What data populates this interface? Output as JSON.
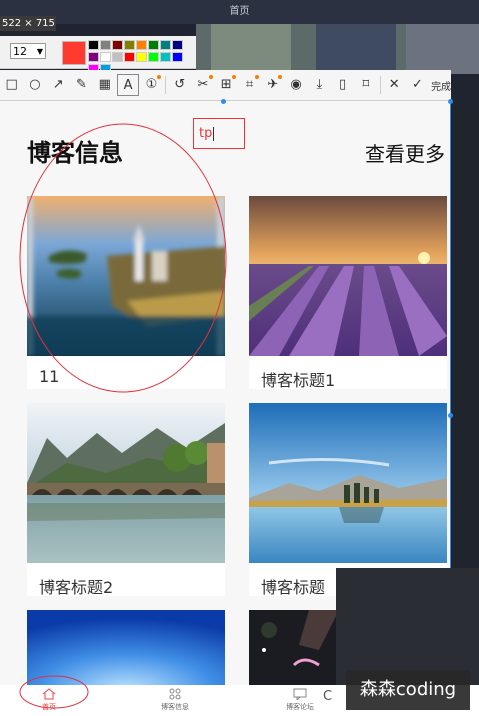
{
  "app": {
    "window_title": "首页",
    "capture_dims": "522 × 715"
  },
  "style_toolbar": {
    "font_size": "12",
    "current_color": "#ff3b30",
    "palette": [
      "#000000",
      "#808080",
      "#800000",
      "#808000",
      "#ff8000",
      "#008000",
      "#008080",
      "#000080",
      "#800080",
      "#ffffff",
      "#c0c0c0",
      "#ff0000",
      "#ffff00",
      "#00ff00",
      "#00c0c0",
      "#0000ff",
      "#ff00ff",
      "#00a0e0"
    ]
  },
  "tools": [
    {
      "name": "rectangle-tool",
      "glyph": "□"
    },
    {
      "name": "ellipse-tool",
      "glyph": "○"
    },
    {
      "name": "arrow-tool",
      "glyph": "↗"
    },
    {
      "name": "pencil-tool",
      "glyph": "✎"
    },
    {
      "name": "mosaic-tool",
      "glyph": "▦"
    },
    {
      "name": "text-tool",
      "glyph": "A",
      "selected": true
    },
    {
      "name": "number-tool",
      "glyph": "①",
      "dot": true
    },
    {
      "name": "undo-tool",
      "glyph": "↺",
      "sep_before": true
    },
    {
      "name": "scissors-tool",
      "glyph": "✂",
      "dot": true
    },
    {
      "name": "ocr-tool",
      "glyph": "⊞",
      "dot": true
    },
    {
      "name": "crop-tool",
      "glyph": "⌗",
      "dot": true
    },
    {
      "name": "pin-tool",
      "glyph": "✈",
      "dot": true
    },
    {
      "name": "record-tool",
      "glyph": "◉"
    },
    {
      "name": "download-tool",
      "glyph": "⤓"
    },
    {
      "name": "phone-tool",
      "glyph": "▯"
    },
    {
      "name": "bookmark-tool",
      "glyph": "⌑"
    },
    {
      "name": "close-tool",
      "glyph": "✕",
      "sep_before": true
    },
    {
      "name": "done-tool",
      "glyph": "✓"
    }
  ],
  "finish_label": "完成",
  "page": {
    "section_title": "博客信息",
    "see_more": "查看更多",
    "cards": [
      {
        "caption": "11"
      },
      {
        "caption": "博客标题1"
      },
      {
        "caption": "博客标题2"
      },
      {
        "caption": "博客标题"
      },
      {
        "caption": ""
      },
      {
        "caption": ""
      }
    ],
    "text_input_value": "tp"
  },
  "bottom_nav": [
    {
      "label": "首页",
      "icon": "home-icon"
    },
    {
      "label": "博客信息",
      "icon": "grid-icon"
    },
    {
      "label": "博客论坛",
      "icon": "chat-icon"
    }
  ],
  "partial_text": "C",
  "watermark": "森森coding"
}
